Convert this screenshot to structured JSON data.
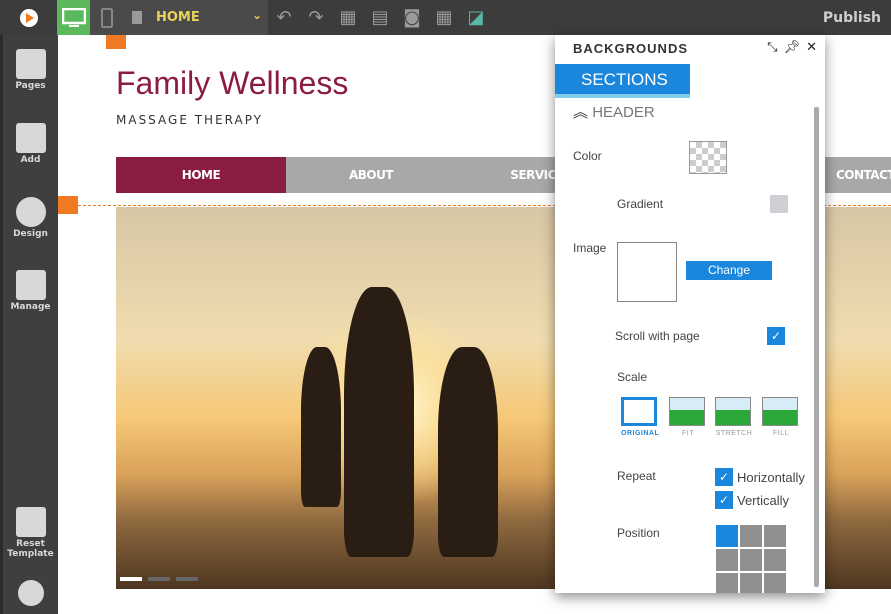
{
  "topbar": {
    "page_name": "HOME",
    "publish_label": "Publish",
    "icons": [
      "logo-icon",
      "desktop-icon",
      "mobile-icon",
      "page-icon",
      "undo-icon",
      "redo-icon",
      "copy-icon",
      "paste-icon",
      "preview-icon",
      "grid-icon",
      "fit-icon"
    ]
  },
  "sidebar": {
    "items": [
      {
        "label": "Pages",
        "icon": "pages-icon"
      },
      {
        "label": "Add",
        "icon": "add-icon"
      },
      {
        "label": "Design",
        "icon": "palette-icon"
      },
      {
        "label": "Manage",
        "icon": "cabinet-icon"
      },
      {
        "label": "Reset Template",
        "icon": "reset-icon"
      },
      {
        "label": "",
        "icon": "settings-icon"
      }
    ]
  },
  "site": {
    "title": "Family Wellness",
    "subtitle": "MASSAGE THERAPY",
    "nav": [
      "HOME",
      "ABOUT",
      "SERVICES",
      "CONTACT"
    ],
    "active_nav": "HOME",
    "slides": 3,
    "active_slide": 1
  },
  "panel": {
    "title": "BACKGROUNDS",
    "tab": "SECTIONS",
    "section": "HEADER",
    "color_label": "Color",
    "gradient_label": "Gradient",
    "image_label": "Image",
    "change_label": "Change",
    "scroll_label": "Scroll with page",
    "scroll_checked": true,
    "scale_label": "Scale",
    "scale_options": [
      "ORIGINAL",
      "FIT",
      "STRETCH",
      "FILL"
    ],
    "scale_selected": "ORIGINAL",
    "repeat_label": "Repeat",
    "repeat_h": "Horizontally",
    "repeat_v": "Vertically",
    "position_label": "Position",
    "position_selected": "top-left"
  },
  "colors": {
    "accent": "#1a87dc",
    "brand": "#8b1c44",
    "handle": "#f07a22",
    "desktop_active": "#5cb85c"
  }
}
